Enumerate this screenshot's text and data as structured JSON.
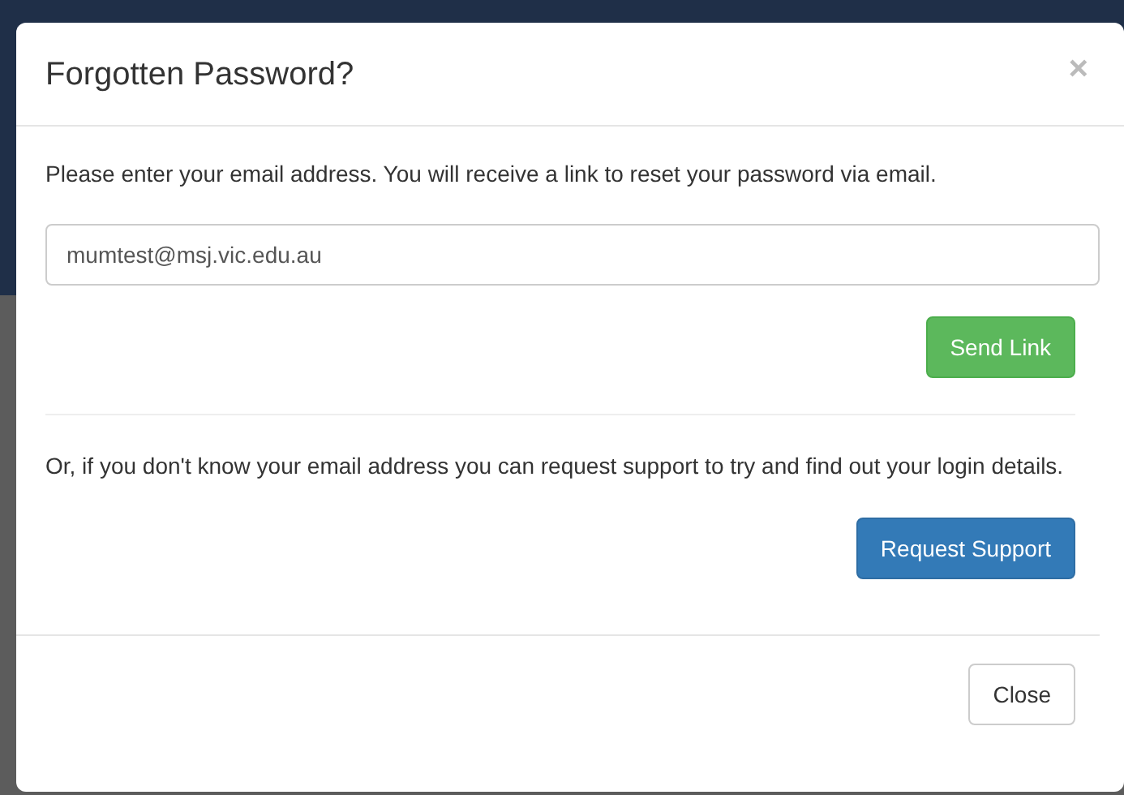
{
  "modal": {
    "title": "Forgotten Password?",
    "close_glyph": "×",
    "instruction": "Please enter your email address. You will receive a link to reset your password via email.",
    "email_field": {
      "value": "mumtest@msj.vic.edu.au"
    },
    "send_button": "Send Link",
    "support_text": "Or, if you don't know your email address you can request support to try and find out your login details.",
    "support_button": "Request Support",
    "footer_button": "Close"
  }
}
